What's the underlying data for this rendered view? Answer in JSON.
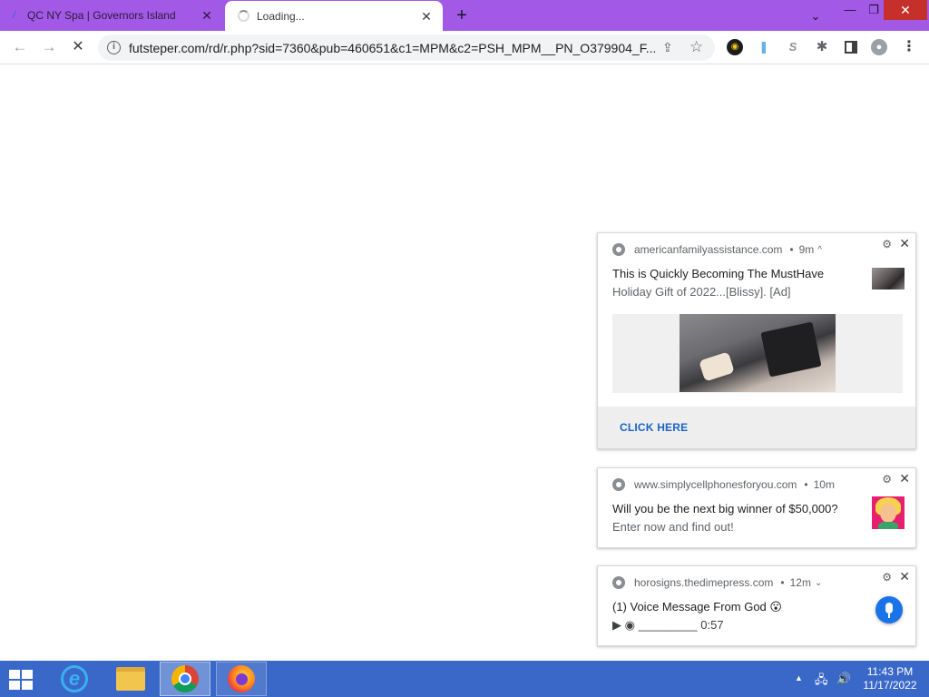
{
  "browser": {
    "tabs": [
      {
        "title": "QC NY Spa | Governors Island",
        "close": "✕",
        "favicon": "page-favicon"
      },
      {
        "title": "Loading...",
        "close": "✕",
        "favicon": "loading-spinner"
      }
    ],
    "new_tab": "+",
    "window_controls": {
      "dropdown": "⌄",
      "minimize": "—",
      "maximize": "❐",
      "close": "✕"
    },
    "toolbar": {
      "back": "←",
      "forward": "→",
      "stop": "✕",
      "url": "futsteper.com/rd/r.php?sid=7360&pub=460651&c1=MPM&c2=PSH_MPM__PN_O379904_F...",
      "share": "⇪",
      "bookmark": "☆",
      "extensions": [
        "extension-icon-1",
        "extension-icon-2",
        "extension-icon-3",
        "puzzle-icon",
        "side-panel-icon",
        "profile-icon"
      ],
      "ext3_glyph": "S",
      "puzzle_glyph": "✱",
      "menu": "⋮"
    }
  },
  "notifications": [
    {
      "site": "americanfamilyassistance.com",
      "time": "9m",
      "expand": "^",
      "title": "This is Quickly Becoming The MustHave",
      "body": "Holiday Gift of 2022...[Blissy].    [Ad]",
      "action": "CLICK HERE"
    },
    {
      "site": "www.simplycellphonesforyou.com",
      "time": "10m",
      "title": "Will you be the next big winner of $50,000?",
      "body": "Enter now and find out!"
    },
    {
      "site": "horosigns.thedimepress.com",
      "time": "12m",
      "expand": "⌄",
      "title": "(1) Voice Message From God 😮",
      "body": "▶ ◉ _________ 0:57"
    }
  ],
  "notification_controls": {
    "settings": "⚙",
    "close": "✕",
    "dot": "•"
  },
  "taskbar": {
    "apps": [
      "internet-explorer-icon",
      "file-explorer-icon",
      "chrome-icon",
      "firefox-icon"
    ],
    "ie_letter": "e",
    "tray_up": "▲",
    "tray_network": "🖧",
    "tray_volume": "🔊",
    "time": "11:43 PM",
    "date": "11/17/2022"
  }
}
